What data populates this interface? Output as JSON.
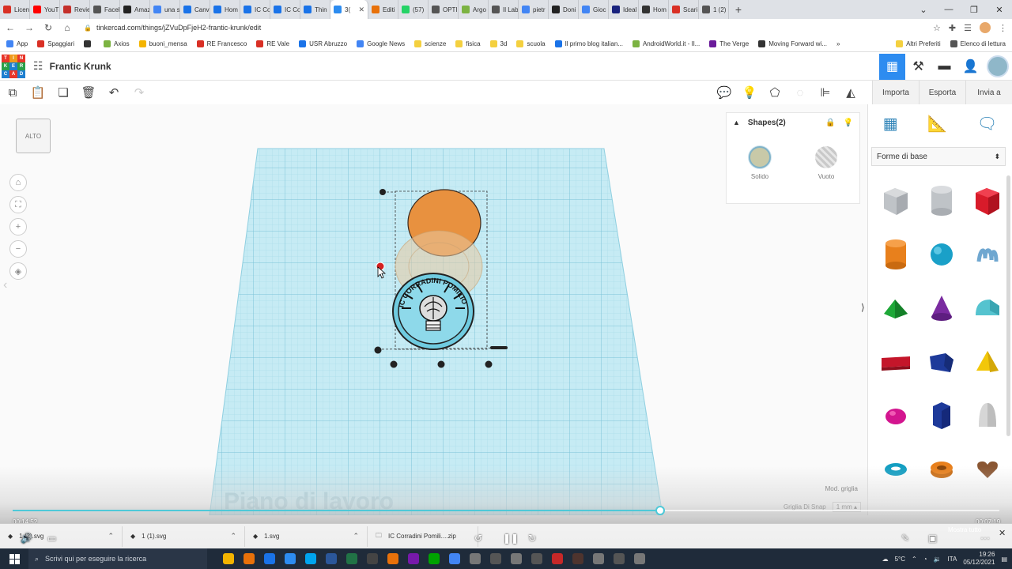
{
  "browser": {
    "tabs": [
      {
        "label": "Licen",
        "color": "#d93025"
      },
      {
        "label": "YouT",
        "color": "#ff0000"
      },
      {
        "label": "Revie",
        "color": "#c4302b"
      },
      {
        "label": "Faceb",
        "color": "#555555"
      },
      {
        "label": "Amaz",
        "color": "#222222"
      },
      {
        "label": "una s",
        "color": "#4285f4"
      },
      {
        "label": "Canv",
        "color": "#1a73e8"
      },
      {
        "label": "Hom",
        "color": "#1a73e8"
      },
      {
        "label": "IC Co",
        "color": "#1a73e8"
      },
      {
        "label": "IC Co",
        "color": "#1a73e8"
      },
      {
        "label": "Thin",
        "color": "#1a73e8"
      },
      {
        "label": "3(",
        "color": "#2d8cf0",
        "active": true
      },
      {
        "label": "Editi",
        "color": "#e8710a"
      },
      {
        "label": "(57)",
        "color": "#25d366"
      },
      {
        "label": "OPTI",
        "color": "#555555"
      },
      {
        "label": "Argo",
        "color": "#7cb342"
      },
      {
        "label": "Il Lab",
        "color": "#555555"
      },
      {
        "label": "pietr",
        "color": "#4285f4"
      },
      {
        "label": "Doni",
        "color": "#222222"
      },
      {
        "label": "Gioc",
        "color": "#4285f4"
      },
      {
        "label": "Ideal",
        "color": "#1a237e"
      },
      {
        "label": "Hom",
        "color": "#333333"
      },
      {
        "label": "Scari",
        "color": "#d93025"
      },
      {
        "label": "1 (2)",
        "color": "#555555"
      }
    ],
    "new_tab": "+",
    "url": "tinkercad.com/things/jZVuDpFjeH2-frantic-krunk/edit",
    "bookmarks": [
      {
        "label": "App",
        "color": "#4285f4"
      },
      {
        "label": "Spaggiari",
        "color": "#d93025"
      },
      {
        "label": "",
        "color": "#333333"
      },
      {
        "label": "Axios",
        "color": "#7cb342"
      },
      {
        "label": "buoni_mensa",
        "color": "#f4b400"
      },
      {
        "label": "RE Francesco",
        "color": "#d93025"
      },
      {
        "label": "RE Vale",
        "color": "#d93025"
      },
      {
        "label": "USR Abruzzo",
        "color": "#1a73e8"
      },
      {
        "label": "Google News",
        "color": "#4285f4"
      },
      {
        "label": "scienze",
        "color": "#f4d03f"
      },
      {
        "label": "fisica",
        "color": "#f4d03f"
      },
      {
        "label": "3d",
        "color": "#f4d03f"
      },
      {
        "label": "scuola",
        "color": "#f4d03f"
      },
      {
        "label": "Il primo blog italian...",
        "color": "#1a73e8"
      },
      {
        "label": "AndroidWorld.it - Il...",
        "color": "#7cb342"
      },
      {
        "label": "The Verge",
        "color": "#6a1b9a"
      },
      {
        "label": "Moving Forward wi...",
        "color": "#333333"
      }
    ],
    "bookmarks_more": "»",
    "bookmarks_right": [
      {
        "label": "Altri Preferiti",
        "color": "#f4d03f"
      },
      {
        "label": "Elenco di lettura",
        "color": "#555555"
      }
    ]
  },
  "tinkercad": {
    "logo_letters": [
      "T",
      "I",
      "N",
      "K",
      "E",
      "R",
      "C",
      "A",
      "D"
    ],
    "project_title": "Frantic Krunk",
    "actions": [
      "Importa",
      "Esporta",
      "Invia a"
    ],
    "viewcube_label": "ALTO",
    "shapes_panel": {
      "title": "Shapes(2)",
      "solid_label": "Solido",
      "hole_label": "Vuoto"
    },
    "workplane_label": "Piano di lavoro",
    "grid_edit": "Mod. griglia",
    "snap_label": "Griglia Di Snap",
    "snap_value": "1 mm",
    "library_category": "Forme di base",
    "medal_text": "IC CORRADINI POMILIO"
  },
  "video": {
    "progress": 0.656,
    "time_elapsed": "00:14:52",
    "time_remaining": "00:07:19",
    "show_all": "Mostra tutto"
  },
  "downloads": [
    {
      "label": "1 (2).svg"
    },
    {
      "label": "1 (1).svg"
    },
    {
      "label": "1.svg"
    },
    {
      "label": "IC Corradini Pomili....zip"
    }
  ],
  "taskbar": {
    "search_placeholder": "Scrivi qui per eseguire la ricerca",
    "weather": "5°C",
    "language": "ITA",
    "time": "19:26",
    "date": "05/12/2021",
    "apps": [
      "#f4b400",
      "#e8710a",
      "#1a73e8",
      "#2d8cf0",
      "#00a4ef",
      "#2b579a",
      "#217346",
      "#444444",
      "#e8710a",
      "#7719aa",
      "#00a300",
      "#4285f4",
      "#777777",
      "#555555",
      "#777777",
      "#555555",
      "#c62828",
      "#4e342e",
      "#777777",
      "#555555",
      "#777777"
    ]
  }
}
